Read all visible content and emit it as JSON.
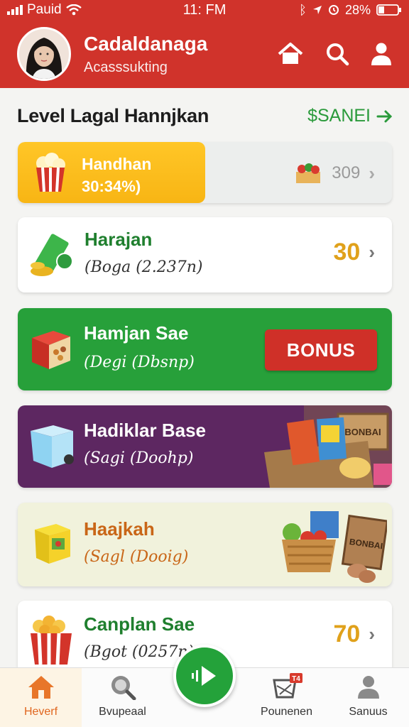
{
  "status_bar": {
    "carrier": "Pauid",
    "time": "11: FM",
    "battery": "28%"
  },
  "header": {
    "name": "Cadaldanaga",
    "subtitle": "Acasssukting",
    "icons": [
      "home-icon",
      "search-icon",
      "user-icon"
    ]
  },
  "section": {
    "title": "Level Lagal Hannjkan",
    "link": "$SANEI"
  },
  "cards": [
    {
      "title": "Handhan",
      "subtitle": "30:34%)",
      "value": "309",
      "progress": 0.5
    },
    {
      "title": "Harajan",
      "subtitle": "(Boga (2.237n)",
      "value": "30"
    },
    {
      "title": "Hamjan Sae",
      "subtitle": "(Degi (Dbsnp)",
      "button": "BONUS"
    },
    {
      "title": "Hadiklar Base",
      "subtitle": "(Sagi (Doohp)",
      "crate_label": "BONBAI"
    },
    {
      "title": "Haajkah",
      "subtitle": "(Sagl (Dooig)",
      "crate_label": "BONBAI"
    },
    {
      "title": "Canplan Sae",
      "subtitle": "(Bgot (0257n)",
      "value": "70"
    }
  ],
  "nav": [
    {
      "label": "Heverf",
      "icon": "home-icon",
      "active": true
    },
    {
      "label": "Bvupeaal",
      "icon": "globe-search-icon"
    },
    {
      "label": "Pounenen",
      "icon": "cart-icon",
      "badge": "T4"
    },
    {
      "label": "Sanuus",
      "icon": "profile-icon"
    }
  ],
  "colors": {
    "primary": "#d0332b",
    "green": "#27a03a",
    "purple": "#5d2761",
    "gold": "#e0a11b"
  }
}
